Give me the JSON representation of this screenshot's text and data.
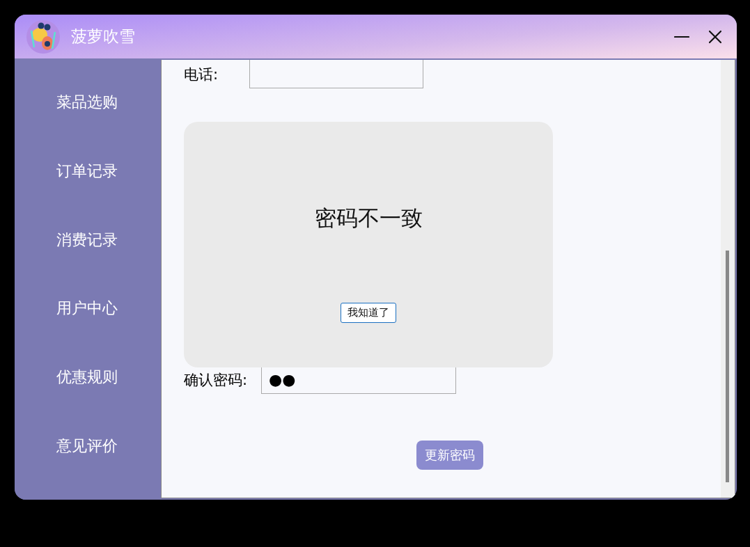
{
  "window": {
    "title": "菠萝吹雪"
  },
  "sidebar": {
    "items": [
      {
        "label": "菜品选购",
        "selected": false
      },
      {
        "label": "订单记录",
        "selected": false
      },
      {
        "label": "消费记录",
        "selected": false
      },
      {
        "label": "用户中心",
        "selected": false
      },
      {
        "label": "优惠规则",
        "selected": false
      },
      {
        "label": "意见评价",
        "selected": false
      }
    ]
  },
  "form": {
    "phone": {
      "label": "电话:"
    },
    "confirm_password": {
      "label": "确认密码:",
      "value": "●●"
    },
    "submit": "更新密码"
  },
  "dialog": {
    "message": "密码不一致",
    "button": "我知道了"
  }
}
